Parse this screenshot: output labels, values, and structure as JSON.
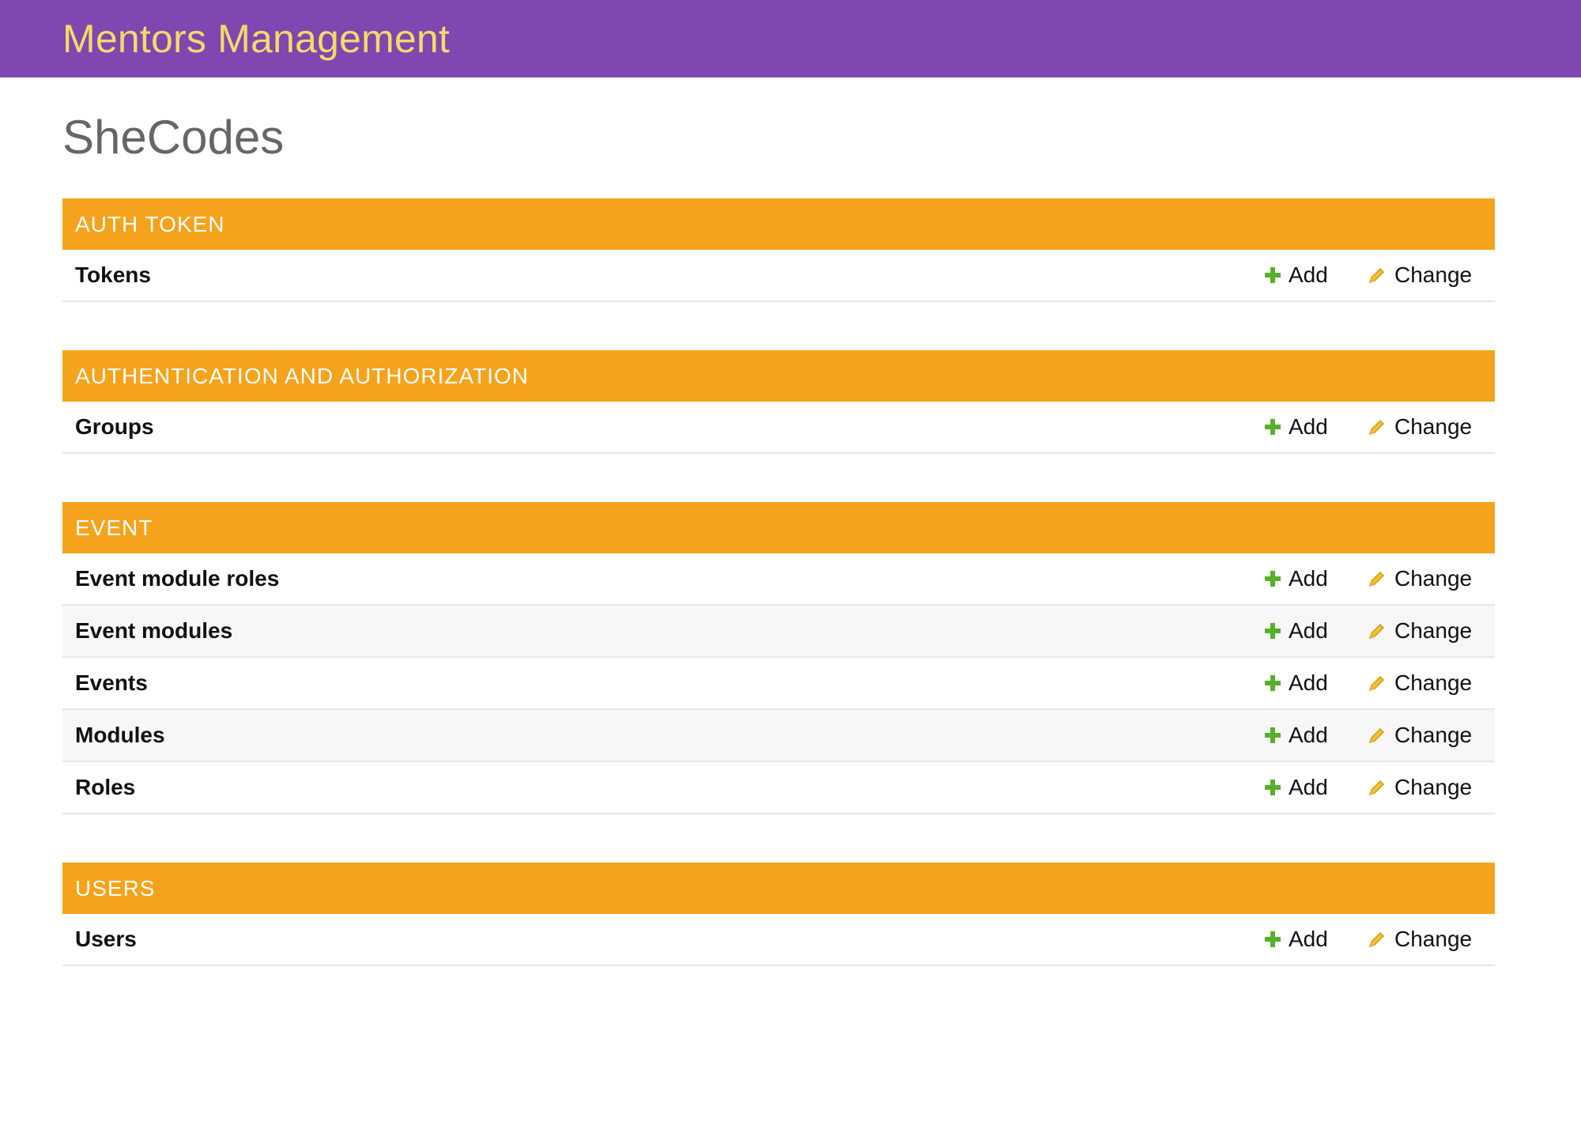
{
  "header": {
    "brand": "Mentors Management",
    "brand_color": "#f7d86b",
    "background": "#7f47af"
  },
  "page": {
    "title": "SheCodes"
  },
  "colors": {
    "module_caption_bg": "#f5a31c",
    "add_icon": "#57b02c",
    "change_icon": "#f1c232"
  },
  "icons": {
    "add": "plus-icon",
    "change": "pencil-icon"
  },
  "modules": [
    {
      "caption": "AUTH TOKEN",
      "rows": [
        {
          "name": "Tokens",
          "add": "Add",
          "change": "Change"
        }
      ]
    },
    {
      "caption": "AUTHENTICATION AND AUTHORIZATION",
      "rows": [
        {
          "name": "Groups",
          "add": "Add",
          "change": "Change"
        }
      ]
    },
    {
      "caption": "EVENT",
      "rows": [
        {
          "name": "Event module roles",
          "add": "Add",
          "change": "Change"
        },
        {
          "name": "Event modules",
          "add": "Add",
          "change": "Change"
        },
        {
          "name": "Events",
          "add": "Add",
          "change": "Change"
        },
        {
          "name": "Modules",
          "add": "Add",
          "change": "Change"
        },
        {
          "name": "Roles",
          "add": "Add",
          "change": "Change"
        }
      ]
    },
    {
      "caption": "USERS",
      "rows": [
        {
          "name": "Users",
          "add": "Add",
          "change": "Change"
        }
      ]
    }
  ]
}
